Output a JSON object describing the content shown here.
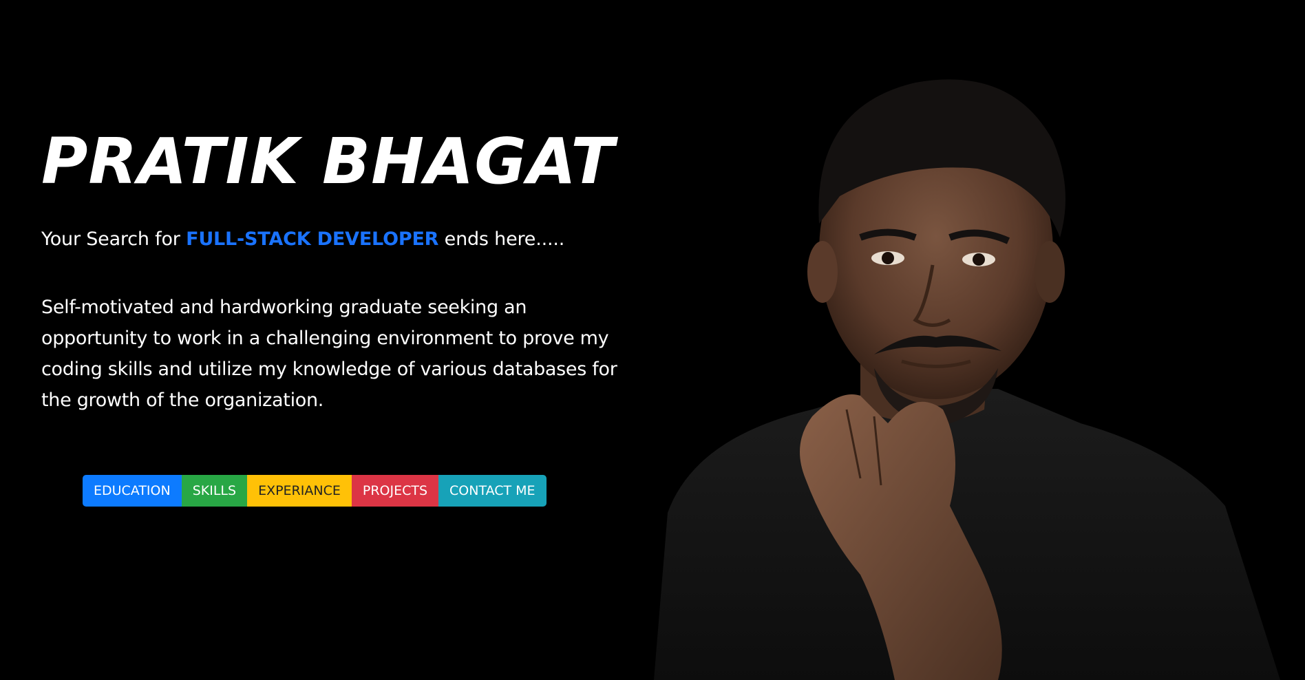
{
  "hero": {
    "name": "PRATIK BHAGAT",
    "tagline_prefix": "Your Search for ",
    "tagline_highlight": "FULL-STACK DEVELOPER",
    "tagline_suffix": " ends here.....",
    "bio": "Self-motivated and hardworking graduate seeking an opportunity to work in a challenging environment to prove my coding skills and utilize my knowledge of various databases for the growth of the organization."
  },
  "nav_buttons": [
    {
      "label": "EDUCATION",
      "color": "#0d7bff"
    },
    {
      "label": "SKILLS",
      "color": "#28a745"
    },
    {
      "label": "EXPERIANCE",
      "color": "#ffc107"
    },
    {
      "label": "PROJECTS",
      "color": "#dc3545"
    },
    {
      "label": "CONTACT ME",
      "color": "#17a2b8"
    }
  ],
  "colors": {
    "background": "#000000",
    "accent": "#1a73ff"
  }
}
